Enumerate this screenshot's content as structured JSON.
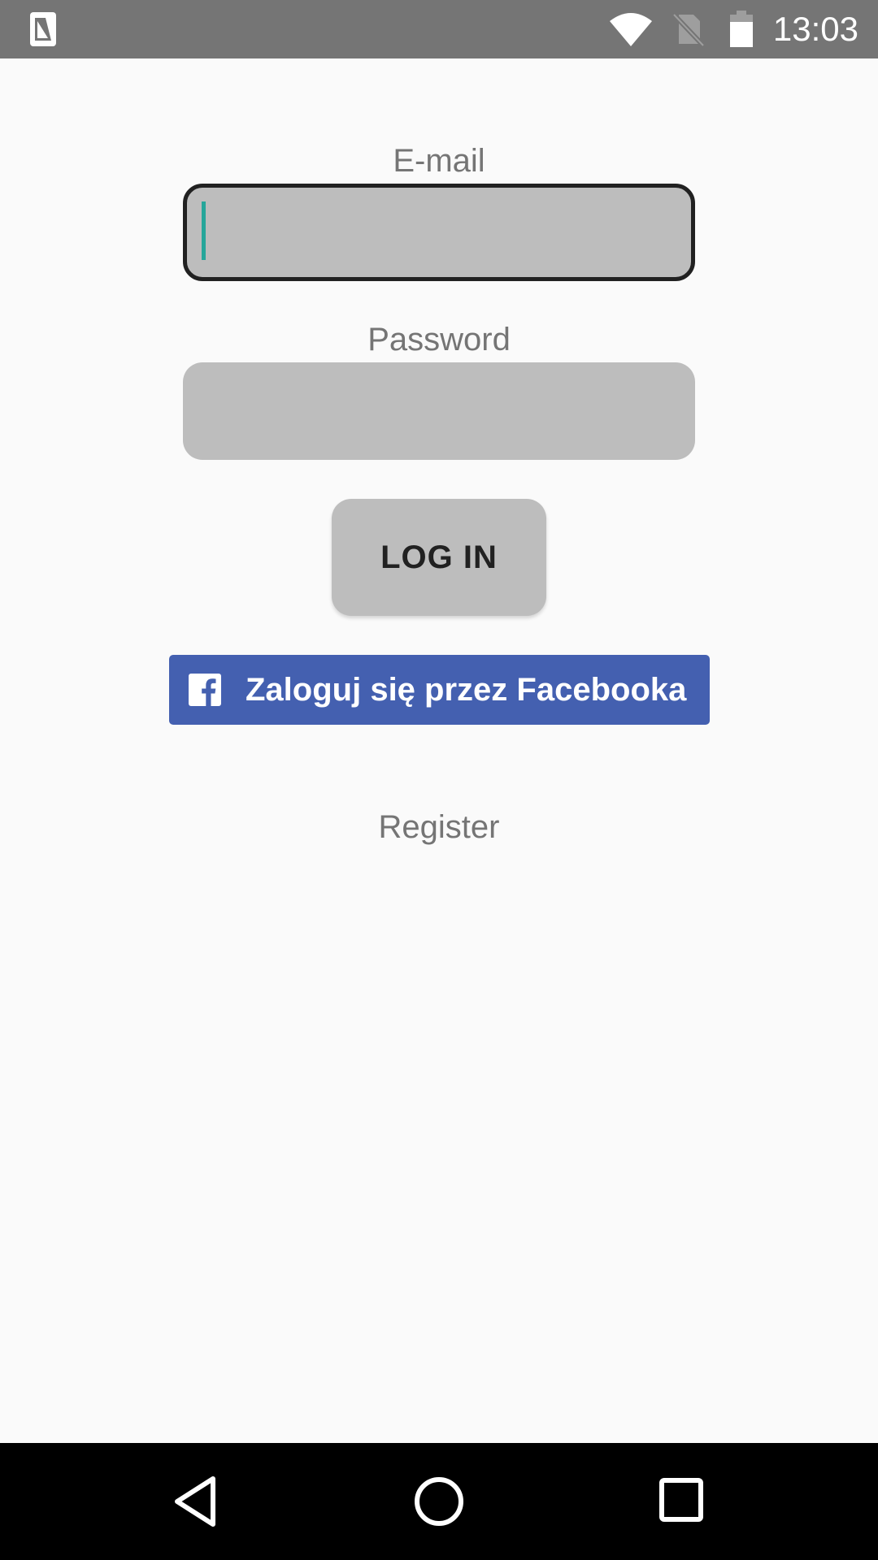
{
  "status_bar": {
    "time": "13:03",
    "icons": [
      "sim-card-icon",
      "wifi-icon",
      "no-sim-icon",
      "battery-icon"
    ]
  },
  "form": {
    "email_label": "E-mail",
    "email_value": "",
    "password_label": "Password",
    "password_value": "",
    "login_label": "LOG IN",
    "facebook_label": "Zaloguj się przez Facebooka",
    "register_label": "Register"
  },
  "colors": {
    "status_bar_bg": "#757575",
    "background": "#fafafa",
    "input_bg": "#bdbdbd",
    "caret": "#26a69a",
    "facebook_blue": "#4460b0",
    "nav_bar_bg": "#000000"
  },
  "nav_bar": {
    "icons": [
      "back-icon",
      "home-icon",
      "recents-icon"
    ]
  }
}
